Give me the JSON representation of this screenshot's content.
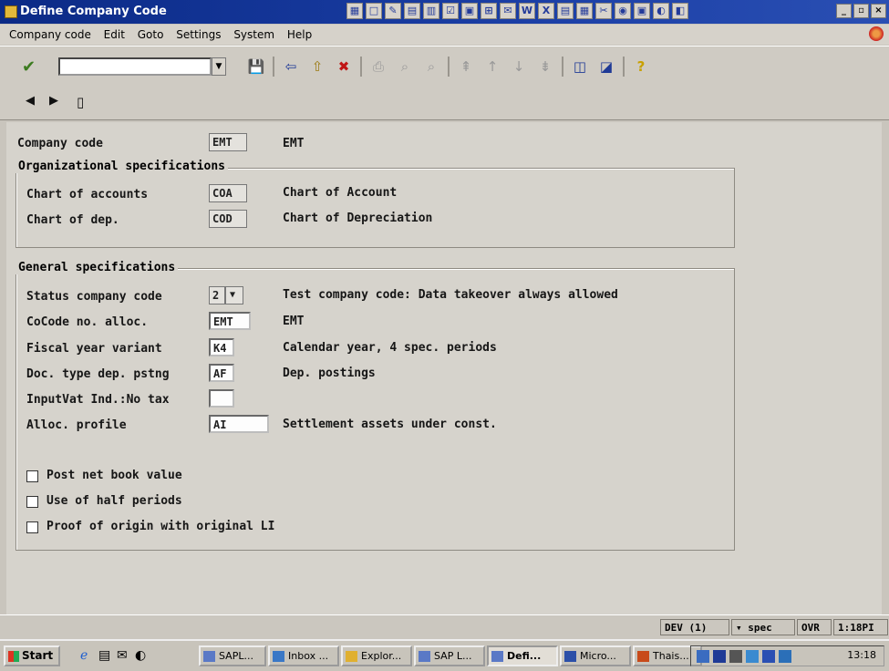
{
  "window": {
    "title": "Define Company Code"
  },
  "menu": [
    "Company code",
    "Edit",
    "Goto",
    "Settings",
    "System",
    "Help"
  ],
  "app_toolbar": {
    "prev": "◀",
    "next": "▶",
    "delete": "🗑"
  },
  "form": {
    "company_code": {
      "label": "Company code",
      "value": "EMT",
      "desc": "EMT"
    },
    "org_group": {
      "title": "Organizational specifications",
      "chart_accounts": {
        "label": "Chart of accounts",
        "value": "COA",
        "desc": "Chart of Account"
      },
      "chart_dep": {
        "label": "Chart of dep.",
        "value": "COD",
        "desc": "Chart of Depreciation"
      }
    },
    "gen_group": {
      "title": "General specifications",
      "status": {
        "label": "Status company code",
        "value": "2",
        "desc": "Test company code: Data takeover always allowed"
      },
      "cocode": {
        "label": "CoCode no. alloc.",
        "value": "EMT",
        "desc": "EMT"
      },
      "fiscal": {
        "label": "Fiscal year variant",
        "value": "K4",
        "desc": "Calendar year, 4 spec. periods"
      },
      "doctype": {
        "label": "Doc. type dep. pstng",
        "value": "AF",
        "desc": "Dep. postings"
      },
      "inputvat": {
        "label": "InputVat Ind.:No tax",
        "value": ""
      },
      "alloc": {
        "label": "Alloc. profile",
        "value": "AI",
        "desc": "Settlement assets under const."
      },
      "checkboxes": [
        "Post net book value",
        "Use of half periods",
        "Proof of origin with original LI"
      ]
    }
  },
  "status": {
    "system": "DEV (1)",
    "server": "spec",
    "mode": "OVR",
    "time": "1:18PI"
  },
  "taskbar": {
    "start": "Start",
    "tasks": [
      "SAPL...",
      "Inbox ...",
      "Explor...",
      "SAP L...",
      "Defi...",
      "Micro...",
      "Thais..."
    ],
    "clock": "13:18"
  }
}
